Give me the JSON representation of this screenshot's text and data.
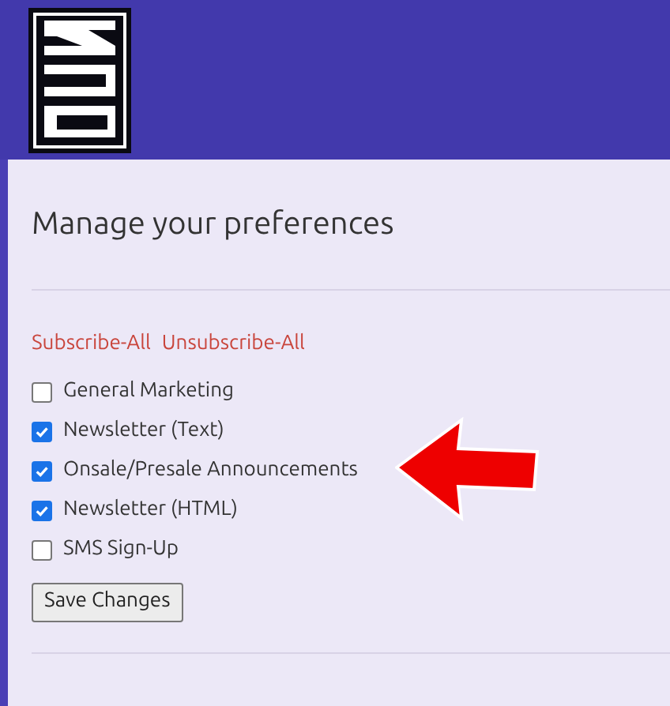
{
  "page": {
    "title": "Manage your preferences"
  },
  "links": [
    "Subscribe-All",
    "Unsubscribe-All"
  ],
  "options": [
    {
      "label": "General Marketing",
      "checked": false
    },
    {
      "label": "Newsletter (Text)",
      "checked": true
    },
    {
      "label": "Onsale/Presale Announcements",
      "checked": true
    },
    {
      "label": "Newsletter (HTML)",
      "checked": true
    },
    {
      "label": "SMS Sign-Up",
      "checked": false
    }
  ],
  "save_button": "Save Changes"
}
